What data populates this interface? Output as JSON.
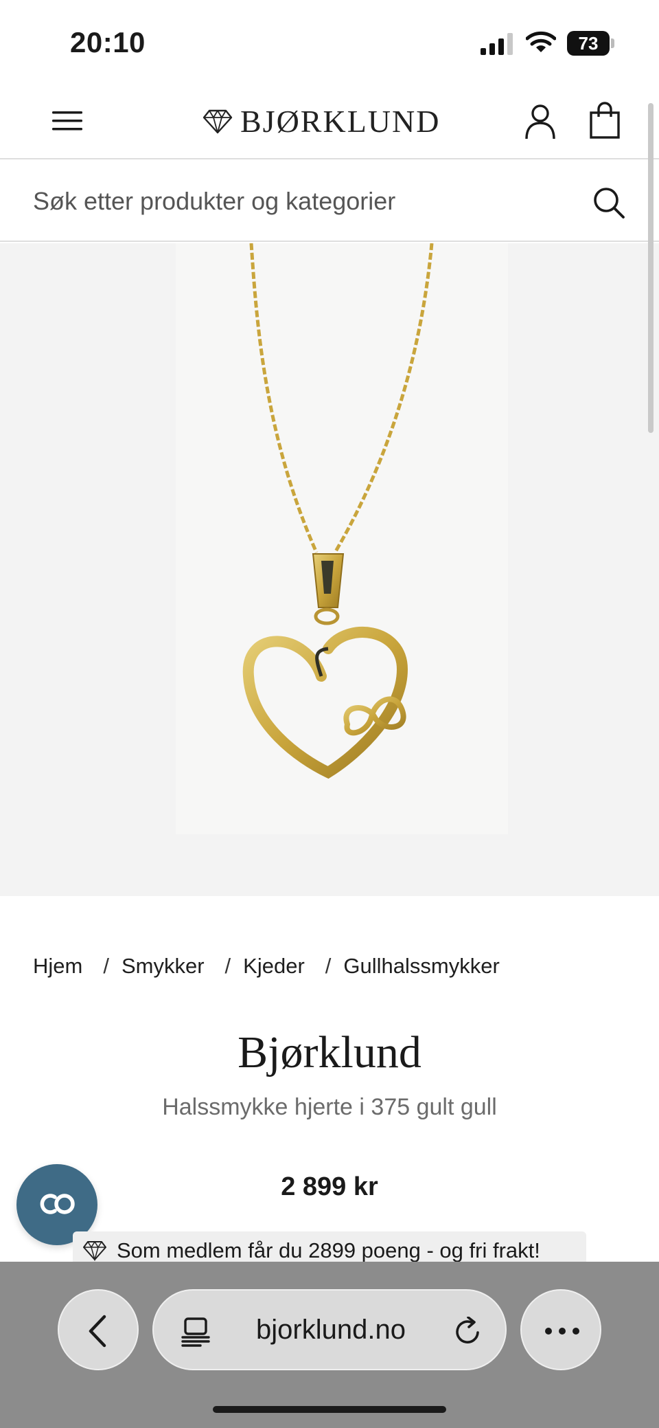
{
  "status_bar": {
    "time": "20:10",
    "battery": "73",
    "icons": [
      "signal-icon",
      "wifi-icon",
      "battery-icon"
    ]
  },
  "header": {
    "logo_text": "BJØRKLUND",
    "icons": [
      "menu-icon",
      "diamond-logo-icon",
      "account-icon",
      "shopping-bag-icon"
    ]
  },
  "search": {
    "placeholder": "Søk etter produkter og kategorier",
    "icon": "search-icon"
  },
  "product_image": {
    "alt": "Halssmykke hjerte i 375 gult gull",
    "colors": {
      "background": "#f3f3f3",
      "gold": "#c9a53c"
    }
  },
  "breadcrumb": [
    {
      "label": "Hjem"
    },
    {
      "label": "Smykker"
    },
    {
      "label": "Kjeder"
    },
    {
      "label": "Gullhalssmykker"
    }
  ],
  "breadcrumb_separator": "/",
  "product": {
    "brand": "Bjørklund",
    "name": "Halssmykke hjerte i 375 gult gull",
    "price": "2 899 kr"
  },
  "member_banner": {
    "text": "Som medlem får du 2899 poeng - og fri frakt!",
    "icon": "diamond-icon"
  },
  "chat": {
    "icon": "chat-icon",
    "color": "#3f6b86"
  },
  "browser": {
    "url": "bjorklund.no",
    "icons": [
      "back-icon",
      "tabs-icon",
      "reload-icon",
      "more-icon"
    ]
  }
}
